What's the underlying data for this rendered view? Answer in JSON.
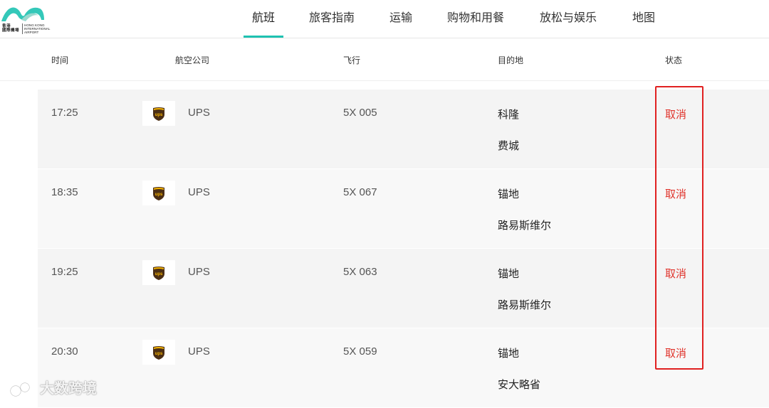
{
  "logo": {
    "cn_lines": [
      "香港",
      "國際機場"
    ],
    "en_lines": [
      "HONG KONG",
      "INTERNATIONAL",
      "AIRPORT"
    ],
    "accent": "#1ec2b1"
  },
  "nav": {
    "tabs": [
      {
        "label": "航班",
        "active": true
      },
      {
        "label": "旅客指南",
        "active": false
      },
      {
        "label": "运输",
        "active": false
      },
      {
        "label": "购物和用餐",
        "active": false
      },
      {
        "label": "放松与娱乐",
        "active": false
      },
      {
        "label": "地图",
        "active": false
      }
    ]
  },
  "table": {
    "columns": [
      "时间",
      "航空公司",
      "飞行",
      "目的地",
      "状态"
    ],
    "rows": [
      {
        "time": "17:25",
        "airline": "UPS",
        "airline_icon": "ups-logo-icon",
        "flight": "5X 005",
        "destinations": [
          "科隆",
          "费城"
        ],
        "status": "取消"
      },
      {
        "time": "18:35",
        "airline": "UPS",
        "airline_icon": "ups-logo-icon",
        "flight": "5X 067",
        "destinations": [
          "锚地",
          "路易斯维尔"
        ],
        "status": "取消"
      },
      {
        "time": "19:25",
        "airline": "UPS",
        "airline_icon": "ups-logo-icon",
        "flight": "5X 063",
        "destinations": [
          "锚地",
          "路易斯维尔"
        ],
        "status": "取消"
      },
      {
        "time": "20:30",
        "airline": "UPS",
        "airline_icon": "ups-logo-icon",
        "flight": "5X 059",
        "destinations": [
          "锚地",
          "安大略省"
        ],
        "status": "取消"
      }
    ]
  },
  "colors": {
    "status_cancelled": "#e0322a",
    "highlight": "#e02020",
    "active_tab_underline": "#1ec2b1"
  },
  "watermark": {
    "text": "大数跨境",
    "icon": "watermark-logo-icon"
  }
}
